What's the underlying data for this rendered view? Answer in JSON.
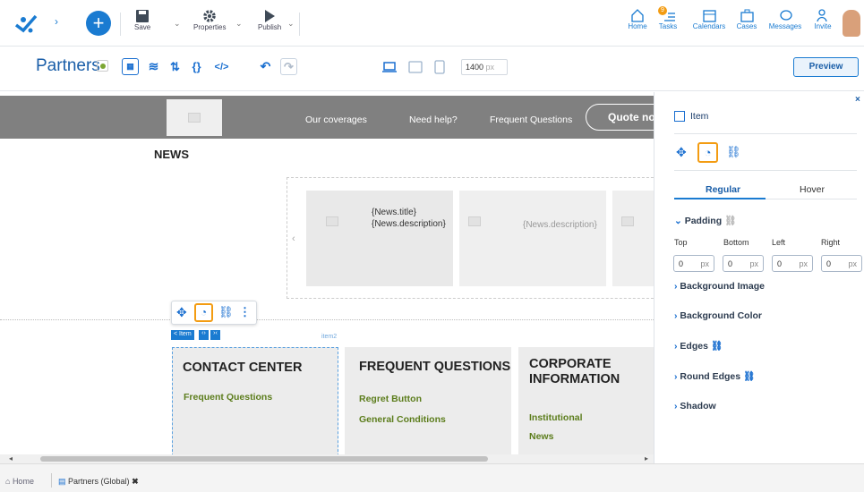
{
  "toolbar": {
    "save": "Save",
    "properties": "Properties",
    "publish": "Publish"
  },
  "nav": [
    {
      "label": "Home",
      "icon": "home-icon"
    },
    {
      "label": "Tasks",
      "icon": "tasks-icon",
      "badge": "9"
    },
    {
      "label": "Calendars",
      "icon": "calendar-icon"
    },
    {
      "label": "Cases",
      "icon": "briefcase-icon"
    },
    {
      "label": "Messages",
      "icon": "message-icon"
    },
    {
      "label": "Invite",
      "icon": "invite-icon"
    }
  ],
  "page": {
    "title": "Partners",
    "width_value": "1400",
    "width_unit": "px",
    "preview": "Preview"
  },
  "site": {
    "menu": [
      "Our coverages",
      "Need help?",
      "Frequent Questions"
    ],
    "quote": "Quote no",
    "news": "NEWS",
    "news_title": "{News.title}",
    "news_desc": "{News.description}",
    "news_desc2": "{News.description}",
    "item_tag": "< Item",
    "item2": "item2",
    "columns": [
      {
        "title": "CONTACT CENTER",
        "links": [
          "Frequent Questions"
        ]
      },
      {
        "title": "FREQUENT QUESTIONS",
        "links": [
          "Regret Button",
          "General Conditions"
        ]
      },
      {
        "title": "CORPORATE INFORMATION",
        "links": [
          "Institutional",
          "News"
        ]
      }
    ]
  },
  "panel": {
    "item": "Item",
    "tabs": [
      "Regular",
      "Hover"
    ],
    "padding": "Padding",
    "labels": [
      "Top",
      "Bottom",
      "Left",
      "Right"
    ],
    "values": [
      "0",
      "0",
      "0",
      "0"
    ],
    "unit": "px",
    "sections": [
      "Background Image",
      "Background Color",
      "Edges",
      "Round Edges",
      "Shadow"
    ]
  },
  "tabs": {
    "home": "Home",
    "current": "Partners (Global)"
  },
  "colors": {
    "accent": "#1a7bd1",
    "orange": "#f39c12",
    "green": "#5c7d1c"
  }
}
